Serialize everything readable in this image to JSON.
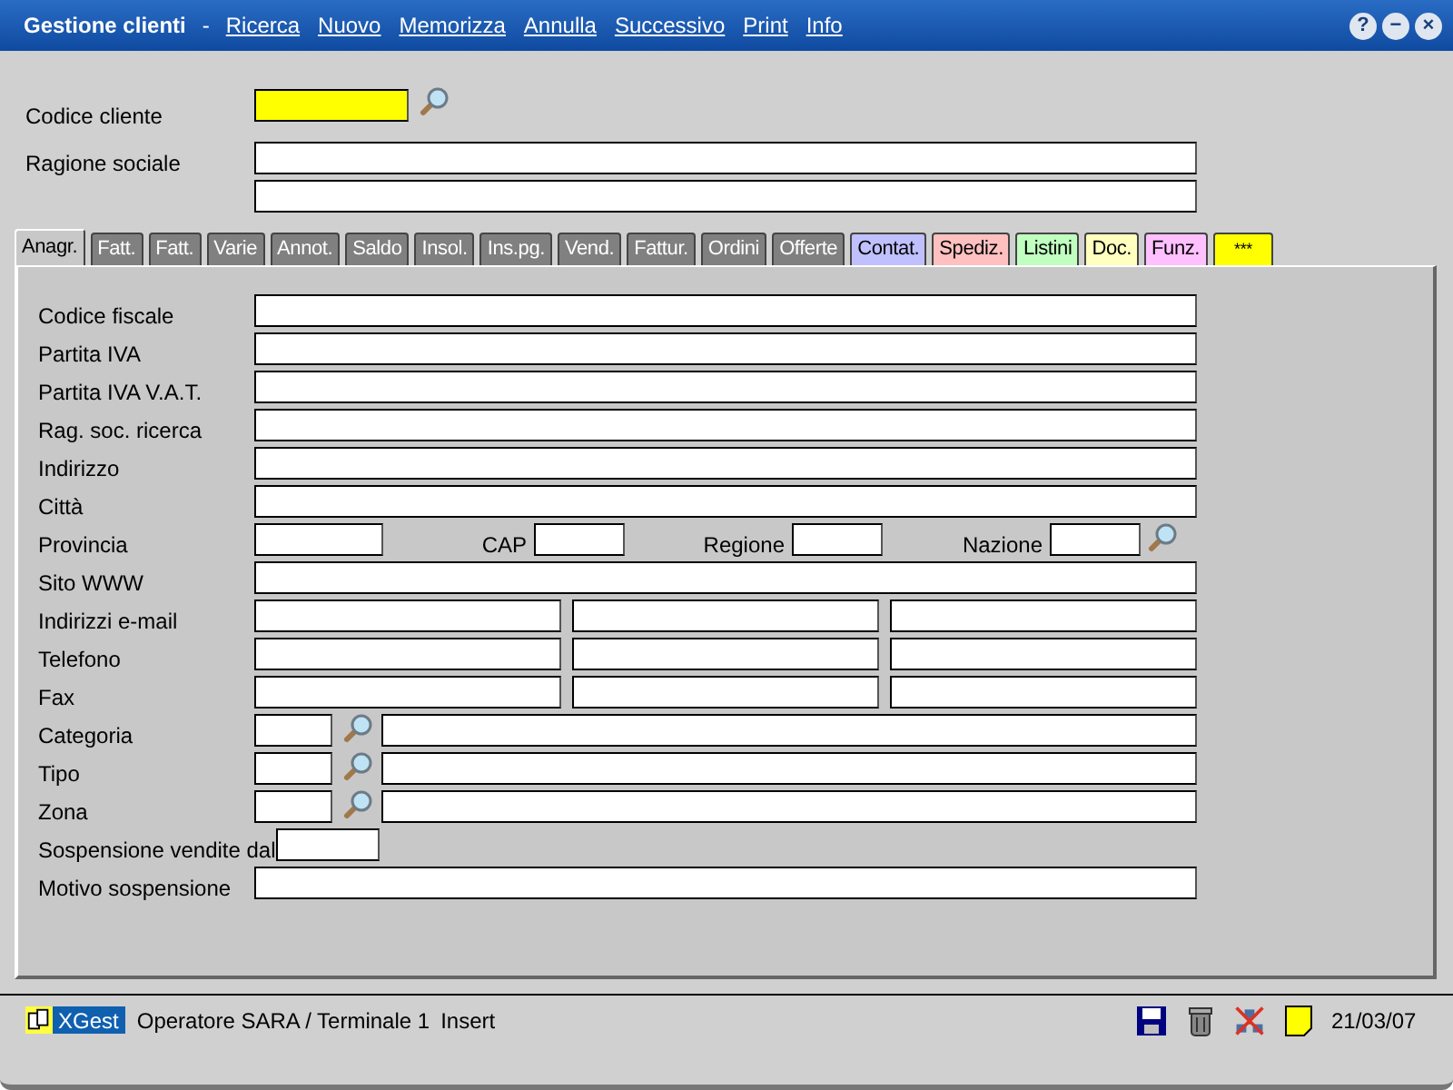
{
  "window": {
    "title": "Gestione clienti",
    "separator": "-",
    "menu": [
      "Ricerca",
      "Nuovo",
      "Memorizza",
      "Annulla",
      "Successivo",
      "Print",
      "Info"
    ],
    "controls": [
      "?",
      "−",
      "×"
    ]
  },
  "header": {
    "code_label": "Codice cliente",
    "name_label": "Ragione sociale"
  },
  "tabs": [
    {
      "label": "Anagr.",
      "selected": true,
      "color": "#c8c8c8"
    },
    {
      "label": "Fatt.",
      "selected": false,
      "color": "#808080"
    },
    {
      "label": "Fatt.",
      "selected": false,
      "color": "#808080"
    },
    {
      "label": "Varie",
      "selected": false,
      "color": "#808080"
    },
    {
      "label": "Annot.",
      "selected": false,
      "color": "#808080"
    },
    {
      "label": "Saldo",
      "selected": false,
      "color": "#808080"
    },
    {
      "label": "Insol.",
      "selected": false,
      "color": "#808080"
    },
    {
      "label": "Ins.pg.",
      "selected": false,
      "color": "#808080"
    },
    {
      "label": "Vend.",
      "selected": false,
      "color": "#808080"
    },
    {
      "label": "Fattur.",
      "selected": false,
      "color": "#808080"
    },
    {
      "label": "Ordini",
      "selected": false,
      "color": "#808080"
    },
    {
      "label": "Offerte",
      "selected": false,
      "color": "#808080"
    },
    {
      "label": "Contat.",
      "selected": false,
      "color": "#c0c0ff"
    },
    {
      "label": "Spediz.",
      "selected": false,
      "color": "#ffc0c0"
    },
    {
      "label": "Listini",
      "selected": false,
      "color": "#c0ffc0"
    },
    {
      "label": "Doc.",
      "selected": false,
      "color": "#ffffc0"
    },
    {
      "label": "Funz.",
      "selected": false,
      "color": "#ffc0ff"
    },
    {
      "label": "***",
      "selected": false,
      "color": "#ffff00"
    }
  ],
  "form": [
    {
      "kind": "full",
      "label": "Codice fiscale"
    },
    {
      "kind": "full",
      "label": "Partita IVA"
    },
    {
      "kind": "full",
      "label": "Partita IVA V.A.T."
    },
    {
      "kind": "full",
      "label": "Rag. soc. ricerca"
    },
    {
      "kind": "full",
      "label": "Indirizzo"
    },
    {
      "kind": "full",
      "label": "Città"
    },
    {
      "kind": "location",
      "label": "Provincia",
      "extras": [
        {
          "label": "CAP",
          "lookup": false
        },
        {
          "label": "Regione",
          "lookup": false
        },
        {
          "label": "Nazione",
          "lookup": true
        }
      ]
    },
    {
      "kind": "full",
      "label": "Sito WWW"
    },
    {
      "kind": "triple",
      "label": "Indirizzi e-mail"
    },
    {
      "kind": "triple",
      "label": "Telefono"
    },
    {
      "kind": "triple",
      "label": "Fax"
    },
    {
      "kind": "lookup",
      "label": "Categoria"
    },
    {
      "kind": "lookup",
      "label": "Tipo"
    },
    {
      "kind": "lookup",
      "label": "Zona"
    },
    {
      "kind": "short",
      "label": "Sospensione vendite dal"
    },
    {
      "kind": "full",
      "label": "Motivo sospensione"
    }
  ],
  "status_bar": {
    "app": "XGest",
    "operator": "Operatore SARA / Terminale 1",
    "mode": "Insert",
    "date": "21/03/07"
  }
}
